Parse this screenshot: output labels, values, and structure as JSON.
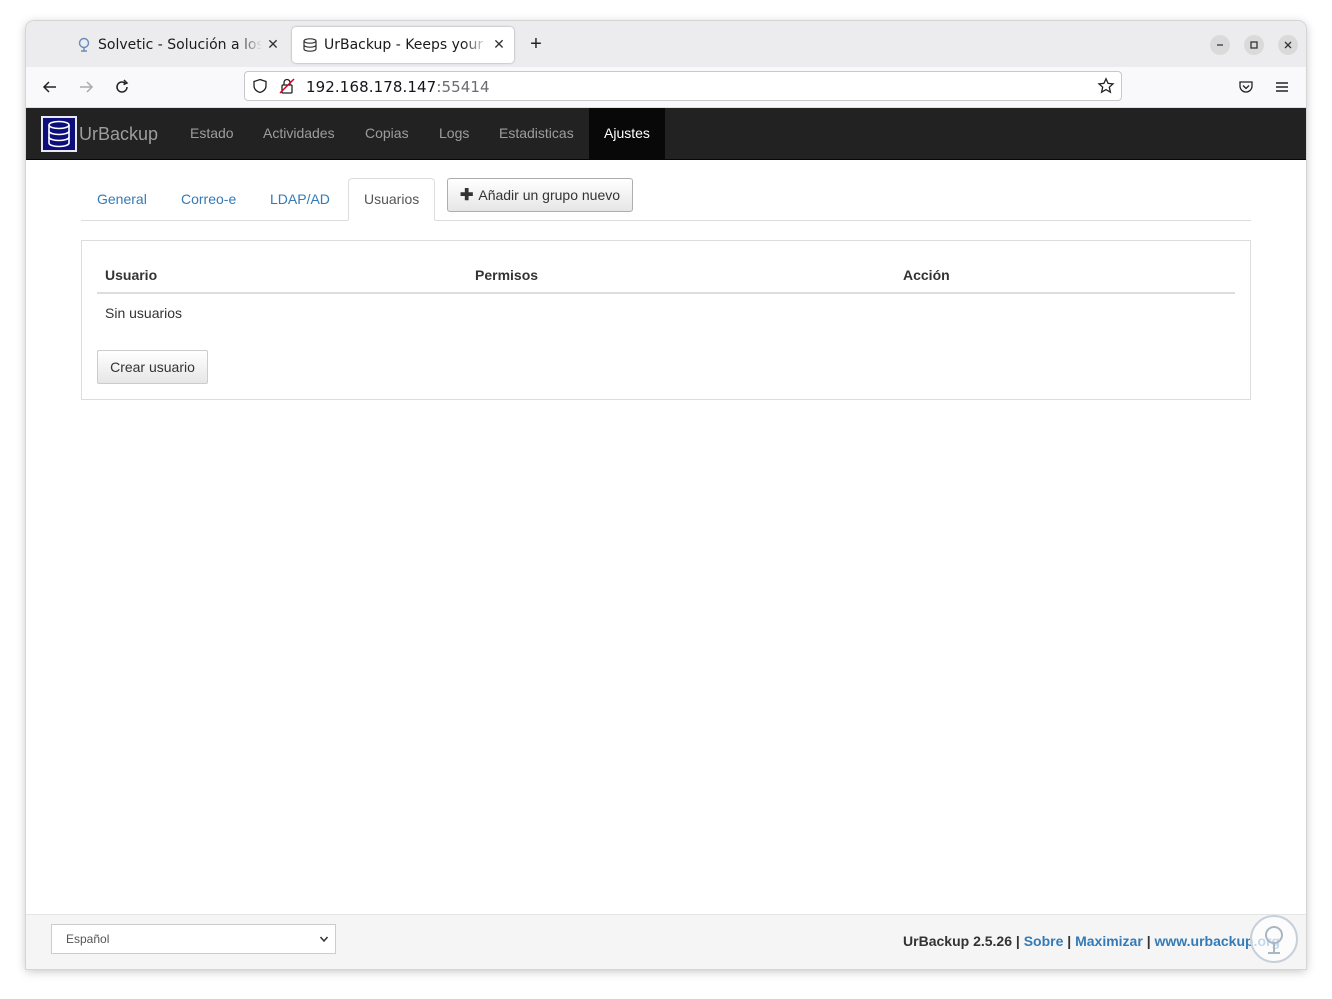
{
  "browser": {
    "tabs": [
      {
        "title": "Solvetic - Solución a los pr",
        "active": false
      },
      {
        "title": "UrBackup - Keeps your da",
        "active": true
      }
    ],
    "new_tab": "+",
    "url_host": "192.168.178.147",
    "url_port": ":55414"
  },
  "app": {
    "brand": "UrBackup",
    "nav": [
      "Estado",
      "Actividades",
      "Copias",
      "Logs",
      "Estadisticas",
      "Ajustes"
    ],
    "active_nav": "Ajustes"
  },
  "settings": {
    "tabs": [
      "General",
      "Correo-e",
      "LDAP/AD",
      "Usuarios"
    ],
    "active_tab": "Usuarios",
    "add_group_label": "Añadir un grupo nuevo"
  },
  "users_table": {
    "headers": [
      "Usuario",
      "Permisos",
      "Acción"
    ],
    "empty_text": "Sin usuarios",
    "create_label": "Crear usuario"
  },
  "footer": {
    "language": "Español",
    "version": "UrBackup 2.5.26",
    "sep": "|",
    "links": [
      "Sobre",
      "Maximizar",
      "www.urbackup.org"
    ]
  },
  "colors": {
    "navbar_bg": "#222222",
    "link": "#337ab7",
    "active_nav_bg": "#080808"
  }
}
